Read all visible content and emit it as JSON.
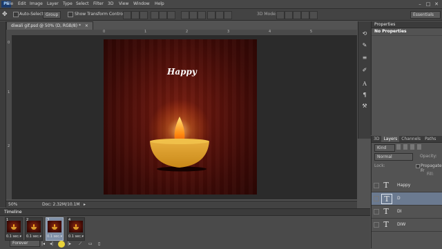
{
  "menubar": {
    "items": [
      "File",
      "Edit",
      "Image",
      "Layer",
      "Type",
      "Select",
      "Filter",
      "3D",
      "View",
      "Window",
      "Help"
    ],
    "window_controls": [
      "–",
      "□",
      "✕"
    ]
  },
  "optionsbar": {
    "auto_select_label": "Auto-Select:",
    "auto_select_value": "Group",
    "transform_label": "Show Transform Controls",
    "mode3d_label": "3D Mode:",
    "workspace_value": "Essentials"
  },
  "document": {
    "tab_title": "diwali gif.psd @ 50% (D, RGB/8) *",
    "close_glyph": "×",
    "art_text": "Happy"
  },
  "rulers": {
    "top": [
      "0",
      "1",
      "2",
      "3",
      "4",
      "5"
    ],
    "left": [
      "0",
      "1",
      "2"
    ]
  },
  "statusbar": {
    "zoom": "50%",
    "doc_info": "Doc: 2.32M/10.1M",
    "arrow": "▸"
  },
  "properties": {
    "title": "Properties",
    "message": "No Properties"
  },
  "layers_panel": {
    "tabs": [
      "3D",
      "Layers",
      "Channels",
      "Paths"
    ],
    "active_tab": "Layers",
    "kind_label": "Kind",
    "blend_mode": "Normal",
    "opacity_label": "Opacity:",
    "lock_label": "Lock:",
    "propagate_label": "Propagate Fr",
    "fill_label": "Fill:",
    "layers": [
      {
        "name": "Happy",
        "thumb": "T"
      },
      {
        "name": "D",
        "thumb": "T"
      },
      {
        "name": "DI",
        "thumb": "T"
      },
      {
        "name": "DIW",
        "thumb": "T"
      }
    ]
  },
  "timeline": {
    "title": "Timeline",
    "frames": [
      {
        "num": "1",
        "dur": "0.1 sec.▾"
      },
      {
        "num": "2",
        "dur": "0.1 sec.▾"
      },
      {
        "num": "3",
        "dur": "0.1 sec.▾"
      },
      {
        "num": "4",
        "dur": "0.1 sec.▾"
      }
    ],
    "selected_frame": 3,
    "loop_value": "Forever"
  },
  "colors": {
    "ui_dark": "#3b3b3b",
    "ui_mid": "#535353",
    "canvas_bg": "#4a0d06",
    "diya": "#d79a2a",
    "flame": "#ff9a1a"
  }
}
